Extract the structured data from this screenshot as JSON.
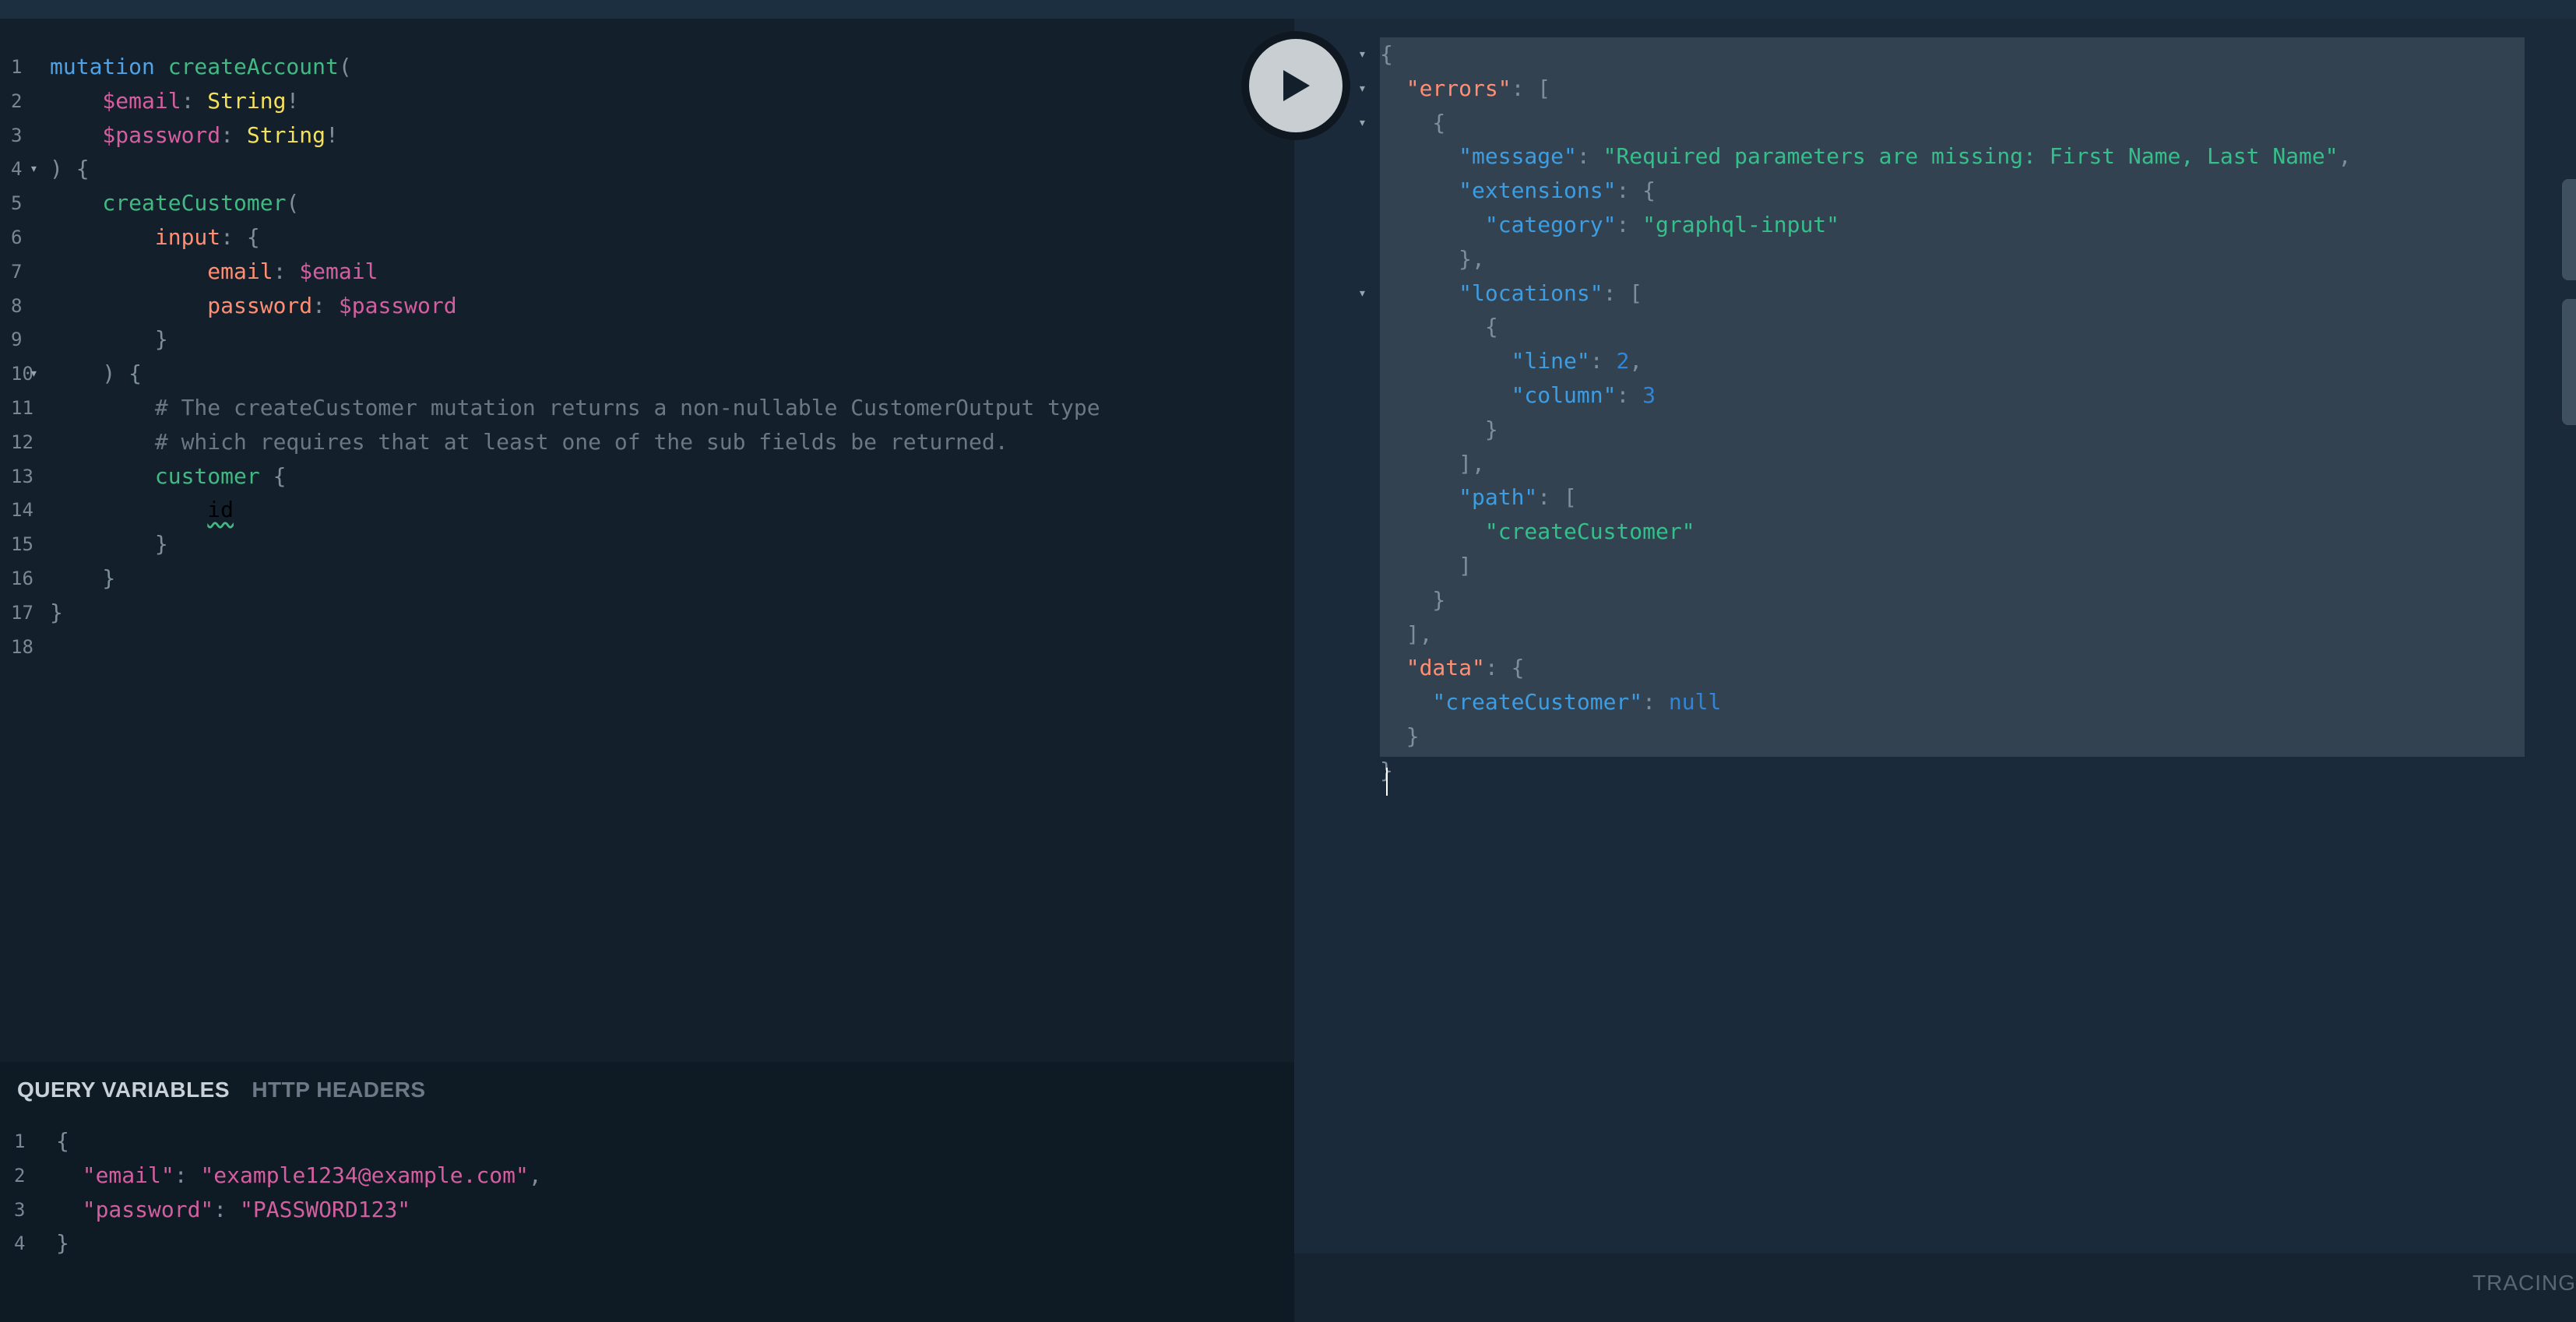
{
  "query_lines": [
    {
      "n": "1",
      "tokens": [
        [
          "kw",
          "mutation "
        ],
        [
          "fn",
          "createAccount"
        ],
        [
          "punct",
          "("
        ]
      ]
    },
    {
      "n": "2",
      "tokens": [
        [
          "var",
          "    $email"
        ],
        [
          "punct",
          ": "
        ],
        [
          "type",
          "String"
        ],
        [
          "punct",
          "!"
        ]
      ]
    },
    {
      "n": "3",
      "tokens": [
        [
          "var",
          "    $password"
        ],
        [
          "punct",
          ": "
        ],
        [
          "type",
          "String"
        ],
        [
          "punct",
          "!"
        ]
      ]
    },
    {
      "n": "4",
      "fold": true,
      "tokens": [
        [
          "punct",
          ") {"
        ]
      ]
    },
    {
      "n": "5",
      "tokens": [
        [
          "fn",
          "    createCustomer"
        ],
        [
          "punct",
          "("
        ]
      ]
    },
    {
      "n": "6",
      "tokens": [
        [
          "field",
          "        input"
        ],
        [
          "punct",
          ": {"
        ]
      ]
    },
    {
      "n": "7",
      "tokens": [
        [
          "field",
          "            email"
        ],
        [
          "punct",
          ": "
        ],
        [
          "var",
          "$email"
        ]
      ]
    },
    {
      "n": "8",
      "tokens": [
        [
          "field",
          "            password"
        ],
        [
          "punct",
          ": "
        ],
        [
          "var",
          "$password"
        ]
      ]
    },
    {
      "n": "9",
      "tokens": [
        [
          "punct",
          "        }"
        ]
      ]
    },
    {
      "n": "10",
      "fold": true,
      "tokens": [
        [
          "punct",
          "    ) {"
        ]
      ]
    },
    {
      "n": "11",
      "tokens": [
        [
          "cmt",
          "        # The createCustomer mutation returns a non-nullable CustomerOutput type"
        ]
      ]
    },
    {
      "n": "12",
      "tokens": [
        [
          "cmt",
          "        # which requires that at least one of the sub fields be returned."
        ]
      ]
    },
    {
      "n": "13",
      "tokens": [
        [
          "fn",
          "        customer "
        ],
        [
          "punct",
          "{"
        ]
      ]
    },
    {
      "n": "14",
      "tokens": [
        [
          "punct",
          "            "
        ],
        [
          "squig",
          "id"
        ]
      ]
    },
    {
      "n": "15",
      "tokens": [
        [
          "punct",
          "        }"
        ]
      ]
    },
    {
      "n": "16",
      "tokens": [
        [
          "punct",
          "    }"
        ]
      ]
    },
    {
      "n": "17",
      "tokens": [
        [
          "punct",
          "}"
        ]
      ]
    },
    {
      "n": "18",
      "tokens": []
    }
  ],
  "tabs": {
    "query_variables": "QUERY VARIABLES",
    "http_headers": "HTTP HEADERS"
  },
  "variables_lines": [
    {
      "n": "1",
      "tokens": [
        [
          "punct",
          "{"
        ]
      ]
    },
    {
      "n": "2",
      "tokens": [
        [
          "var",
          "  \"email\""
        ],
        [
          "punct",
          ": "
        ],
        [
          "var",
          "\"example1234@example.com\""
        ],
        [
          "punct",
          ","
        ]
      ]
    },
    {
      "n": "3",
      "tokens": [
        [
          "var",
          "  \"password\""
        ],
        [
          "punct",
          ": "
        ],
        [
          "var",
          "\"PASSWORD123\""
        ]
      ]
    },
    {
      "n": "4",
      "tokens": [
        [
          "punct",
          "}"
        ]
      ]
    }
  ],
  "result_lines": [
    {
      "fold": true,
      "tokens": [
        [
          "punct",
          "{"
        ]
      ]
    },
    {
      "fold": true,
      "tokens": [
        [
          "jkey",
          "  \"errors\""
        ],
        [
          "punct",
          ": ["
        ]
      ]
    },
    {
      "fold": true,
      "tokens": [
        [
          "punct",
          "    {"
        ]
      ]
    },
    {
      "tokens": [
        [
          "attr",
          "      \"message\""
        ],
        [
          "punct",
          ": "
        ],
        [
          "str",
          "\"Required parameters are missing: First Name, Last Name\""
        ],
        [
          "punct",
          ","
        ]
      ]
    },
    {
      "tokens": [
        [
          "attr",
          "      \"extensions\""
        ],
        [
          "punct",
          ": {"
        ]
      ]
    },
    {
      "tokens": [
        [
          "attr",
          "        \"category\""
        ],
        [
          "punct",
          ": "
        ],
        [
          "str",
          "\"graphql-input\""
        ]
      ]
    },
    {
      "tokens": [
        [
          "punct",
          "      },"
        ]
      ]
    },
    {
      "fold": true,
      "tokens": [
        [
          "attr",
          "      \"locations\""
        ],
        [
          "punct",
          ": ["
        ]
      ]
    },
    {
      "tokens": [
        [
          "punct",
          "        {"
        ]
      ]
    },
    {
      "tokens": [
        [
          "attr",
          "          \"line\""
        ],
        [
          "punct",
          ": "
        ],
        [
          "num",
          "2"
        ],
        [
          "punct",
          ","
        ]
      ]
    },
    {
      "tokens": [
        [
          "attr",
          "          \"column\""
        ],
        [
          "punct",
          ": "
        ],
        [
          "num",
          "3"
        ]
      ]
    },
    {
      "tokens": [
        [
          "punct",
          "        }"
        ]
      ]
    },
    {
      "tokens": [
        [
          "punct",
          "      ],"
        ]
      ]
    },
    {
      "tokens": [
        [
          "attr",
          "      \"path\""
        ],
        [
          "punct",
          ": ["
        ]
      ]
    },
    {
      "tokens": [
        [
          "str",
          "        \"createCustomer\""
        ]
      ]
    },
    {
      "tokens": [
        [
          "punct",
          "      ]"
        ]
      ]
    },
    {
      "tokens": [
        [
          "punct",
          "    }"
        ]
      ]
    },
    {
      "tokens": [
        [
          "punct",
          "  ],"
        ]
      ]
    },
    {
      "tokens": [
        [
          "jkey",
          "  \"data\""
        ],
        [
          "punct",
          ": {"
        ]
      ]
    },
    {
      "tokens": [
        [
          "attr",
          "    \"createCustomer\""
        ],
        [
          "punct",
          ": "
        ],
        [
          "num",
          "null"
        ]
      ]
    },
    {
      "tokens": [
        [
          "punct",
          "  }"
        ]
      ]
    },
    {
      "tokens": [
        [
          "punct",
          "}"
        ]
      ]
    }
  ],
  "tracing_label": "TRACING",
  "icons": {
    "run": "play-icon",
    "fold": "fold-arrow-icon"
  }
}
